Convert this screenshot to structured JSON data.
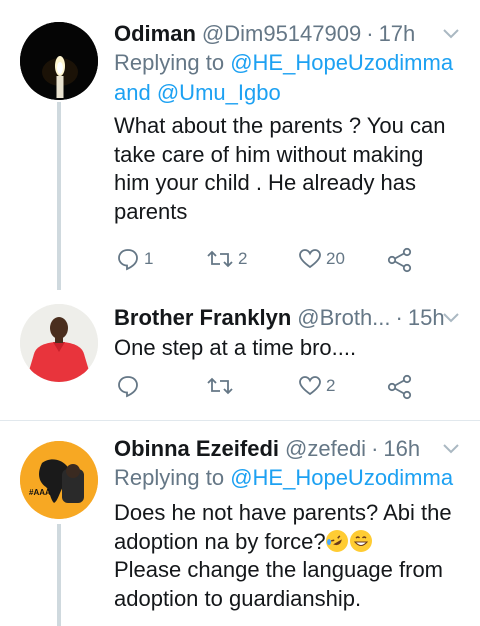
{
  "tweets": [
    {
      "name": "Odiman",
      "handle": "@Dim95147909",
      "time": "17h",
      "replying_prefix": "Replying to",
      "mention_1": "@HE_HopeUzodimma",
      "and_word": "and",
      "mention_2": "@Umu_Igbo",
      "text_lines": [
        "What about the parents ? You can",
        "take care of him without making",
        "him your child . He already has",
        "parents"
      ],
      "replies": "1",
      "retweets": "2",
      "likes": "20"
    },
    {
      "name": "Brother Franklyn",
      "handle": "@Broth...",
      "time": "15h",
      "text_lines": [
        "One step at a time bro...."
      ],
      "replies": "",
      "retweets": "",
      "likes": "2"
    },
    {
      "name": "Obinna Ezeifedi",
      "handle": "@zefedi",
      "time": "16h",
      "replying_prefix": "Replying to",
      "mention_1": "@HE_HopeUzodimma",
      "text_lines": [
        "Does he not have parents? Abi the",
        "adoption na by force?",
        "Please change the language from",
        "adoption to guardianship."
      ],
      "avatar_badge": "#AAA"
    }
  ],
  "icons": {
    "reply": "reply-icon",
    "retweet": "retweet-icon",
    "like": "heart-icon",
    "share": "share-icon",
    "caret": "chevron-down-icon"
  },
  "colors": {
    "name": "#14171a",
    "secondary": "#657786",
    "link": "#1da1f2",
    "divider": "#e1e8ed",
    "thread_line": "#cfd9de"
  }
}
